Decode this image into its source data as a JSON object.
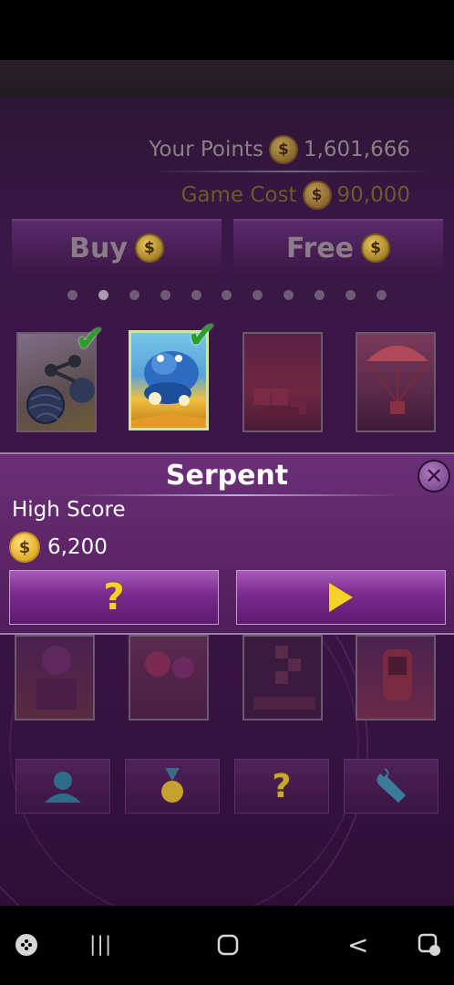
{
  "stats": {
    "points_label": "Your Points",
    "points_value": "1,601,666",
    "cost_label": "Game Cost",
    "cost_value": "90,000",
    "coin_symbol": "$"
  },
  "top_buttons": {
    "buy_label": "Buy",
    "free_label": "Free"
  },
  "carousel": {
    "page_count": 11,
    "active_page": 2
  },
  "games_row1": [
    {
      "icon": "yarn-ball-thumbnail",
      "completed": true
    },
    {
      "icon": "serpent-thumbnail",
      "completed": true,
      "selected": true
    },
    {
      "icon": "red-block-game-thumbnail",
      "completed": false
    },
    {
      "icon": "parachute-thumbnail",
      "completed": false
    }
  ],
  "panel": {
    "title": "Serpent",
    "high_score_label": "High Score",
    "high_score_value": "6,200",
    "help_symbol": "?"
  },
  "bottom_buttons": [
    {
      "icon": "profile-icon"
    },
    {
      "icon": "medal-icon"
    },
    {
      "icon": "help-icon",
      "symbol": "?"
    },
    {
      "icon": "wrench-icon"
    }
  ],
  "system_nav": {
    "recents_symbol": "|||",
    "back_symbol": "<"
  },
  "colors": {
    "accent_yellow": "#f6d12a",
    "check_green": "#2c9c2a",
    "panel_purple": "#6c2f78"
  }
}
